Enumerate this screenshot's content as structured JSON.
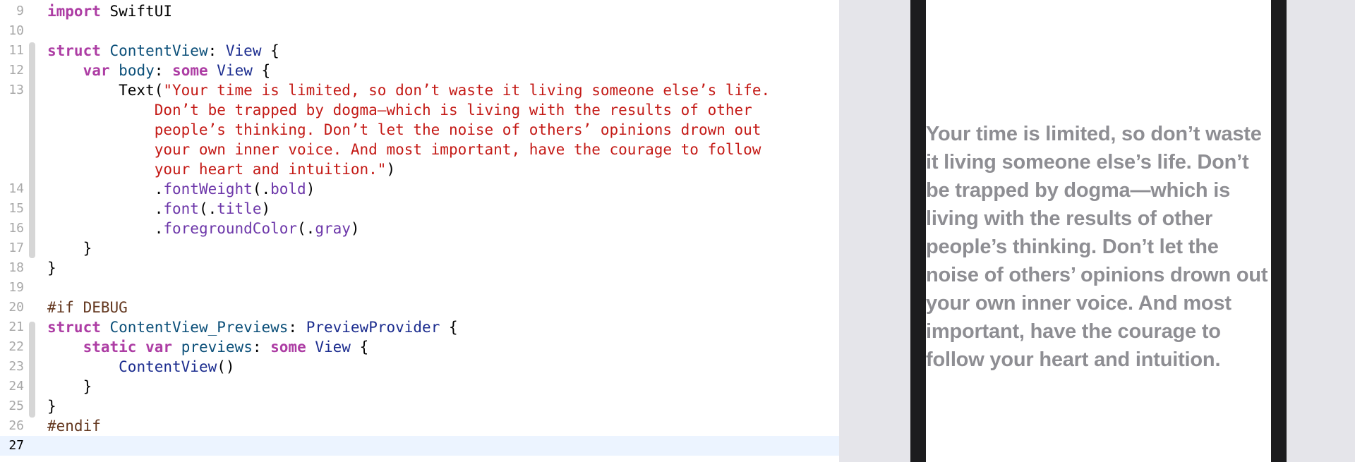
{
  "editor": {
    "current_line": "27",
    "lines": [
      {
        "num": "9",
        "tokens": [
          [
            "kw",
            "import"
          ],
          [
            "pl",
            " SwiftUI"
          ]
        ]
      },
      {
        "num": "10",
        "tokens": []
      },
      {
        "num": "11",
        "tokens": [
          [
            "kw",
            "struct"
          ],
          [
            "pl",
            " "
          ],
          [
            "dec",
            "ContentView"
          ],
          [
            "pl",
            ": "
          ],
          [
            "typ",
            "View"
          ],
          [
            "pl",
            " {"
          ]
        ]
      },
      {
        "num": "12",
        "tokens": [
          [
            "pl",
            "    "
          ],
          [
            "kw",
            "var"
          ],
          [
            "pl",
            " "
          ],
          [
            "dec",
            "body"
          ],
          [
            "pl",
            ": "
          ],
          [
            "kw",
            "some"
          ],
          [
            "pl",
            " "
          ],
          [
            "typ",
            "View"
          ],
          [
            "pl",
            " {"
          ]
        ]
      },
      {
        "num": "13",
        "tokens": [
          [
            "pl",
            "        Text("
          ],
          [
            "str",
            "\"Your time is limited, so don’t waste it living someone else’s life."
          ]
        ]
      },
      {
        "num": "",
        "tokens": [
          [
            "pl",
            "            "
          ],
          [
            "str",
            "Don’t be trapped by dogma—which is living with the results of other"
          ]
        ]
      },
      {
        "num": "",
        "tokens": [
          [
            "pl",
            "            "
          ],
          [
            "str",
            "people’s thinking. Don’t let the noise of others’ opinions drown out"
          ]
        ]
      },
      {
        "num": "",
        "tokens": [
          [
            "pl",
            "            "
          ],
          [
            "str",
            "your own inner voice. And most important, have the courage to follow"
          ]
        ]
      },
      {
        "num": "",
        "tokens": [
          [
            "pl",
            "            "
          ],
          [
            "str",
            "your heart and intuition.\""
          ],
          [
            "pl",
            ")"
          ]
        ]
      },
      {
        "num": "14",
        "tokens": [
          [
            "pl",
            "            ."
          ],
          [
            "fn",
            "fontWeight"
          ],
          [
            "pl",
            "(."
          ],
          [
            "fn",
            "bold"
          ],
          [
            "pl",
            ")"
          ]
        ]
      },
      {
        "num": "15",
        "tokens": [
          [
            "pl",
            "            ."
          ],
          [
            "fn",
            "font"
          ],
          [
            "pl",
            "(."
          ],
          [
            "fn",
            "title"
          ],
          [
            "pl",
            ")"
          ]
        ]
      },
      {
        "num": "16",
        "tokens": [
          [
            "pl",
            "            ."
          ],
          [
            "fn",
            "foregroundColor"
          ],
          [
            "pl",
            "(."
          ],
          [
            "fn",
            "gray"
          ],
          [
            "pl",
            ")"
          ]
        ]
      },
      {
        "num": "17",
        "tokens": [
          [
            "pl",
            "    }"
          ]
        ]
      },
      {
        "num": "18",
        "tokens": [
          [
            "pl",
            "}"
          ]
        ]
      },
      {
        "num": "19",
        "tokens": []
      },
      {
        "num": "20",
        "tokens": [
          [
            "pp",
            "#if DEBUG"
          ]
        ]
      },
      {
        "num": "21",
        "tokens": [
          [
            "kw",
            "struct"
          ],
          [
            "pl",
            " "
          ],
          [
            "dec",
            "ContentView_Previews"
          ],
          [
            "pl",
            ": "
          ],
          [
            "typ",
            "PreviewProvider"
          ],
          [
            "pl",
            " {"
          ]
        ]
      },
      {
        "num": "22",
        "tokens": [
          [
            "pl",
            "    "
          ],
          [
            "kw",
            "static"
          ],
          [
            "pl",
            " "
          ],
          [
            "kw",
            "var"
          ],
          [
            "pl",
            " "
          ],
          [
            "dec",
            "previews"
          ],
          [
            "pl",
            ": "
          ],
          [
            "kw",
            "some"
          ],
          [
            "pl",
            " "
          ],
          [
            "typ",
            "View"
          ],
          [
            "pl",
            " {"
          ]
        ]
      },
      {
        "num": "23",
        "tokens": [
          [
            "pl",
            "        "
          ],
          [
            "typ",
            "ContentView"
          ],
          [
            "pl",
            "()"
          ]
        ]
      },
      {
        "num": "24",
        "tokens": [
          [
            "pl",
            "    }"
          ]
        ]
      },
      {
        "num": "25",
        "tokens": [
          [
            "pl",
            "}"
          ]
        ]
      },
      {
        "num": "26",
        "tokens": [
          [
            "pp",
            "#endif"
          ]
        ]
      },
      {
        "num": "27",
        "tokens": []
      }
    ]
  },
  "preview": {
    "text": "Your time is limited, so don’t waste it living someone else’s life. Don’t be trapped by dogma—which is living with the results of other people’s thinking. Don’t let the noise of others’ opinions drown out your own inner voice. And most important, have the courage to follow your heart and intuition."
  },
  "colors": {
    "keyword": "#ad3da4",
    "type": "#1c2d8f",
    "declaration": "#0b4f79",
    "function": "#6c36a9",
    "string": "#c41a16",
    "preprocessor": "#643820",
    "preview_text": "#8e8e93",
    "canvas": "#e5e5ea",
    "device_bezel": "#1c1c1e",
    "current_line_highlight": "#ecf4ff"
  }
}
